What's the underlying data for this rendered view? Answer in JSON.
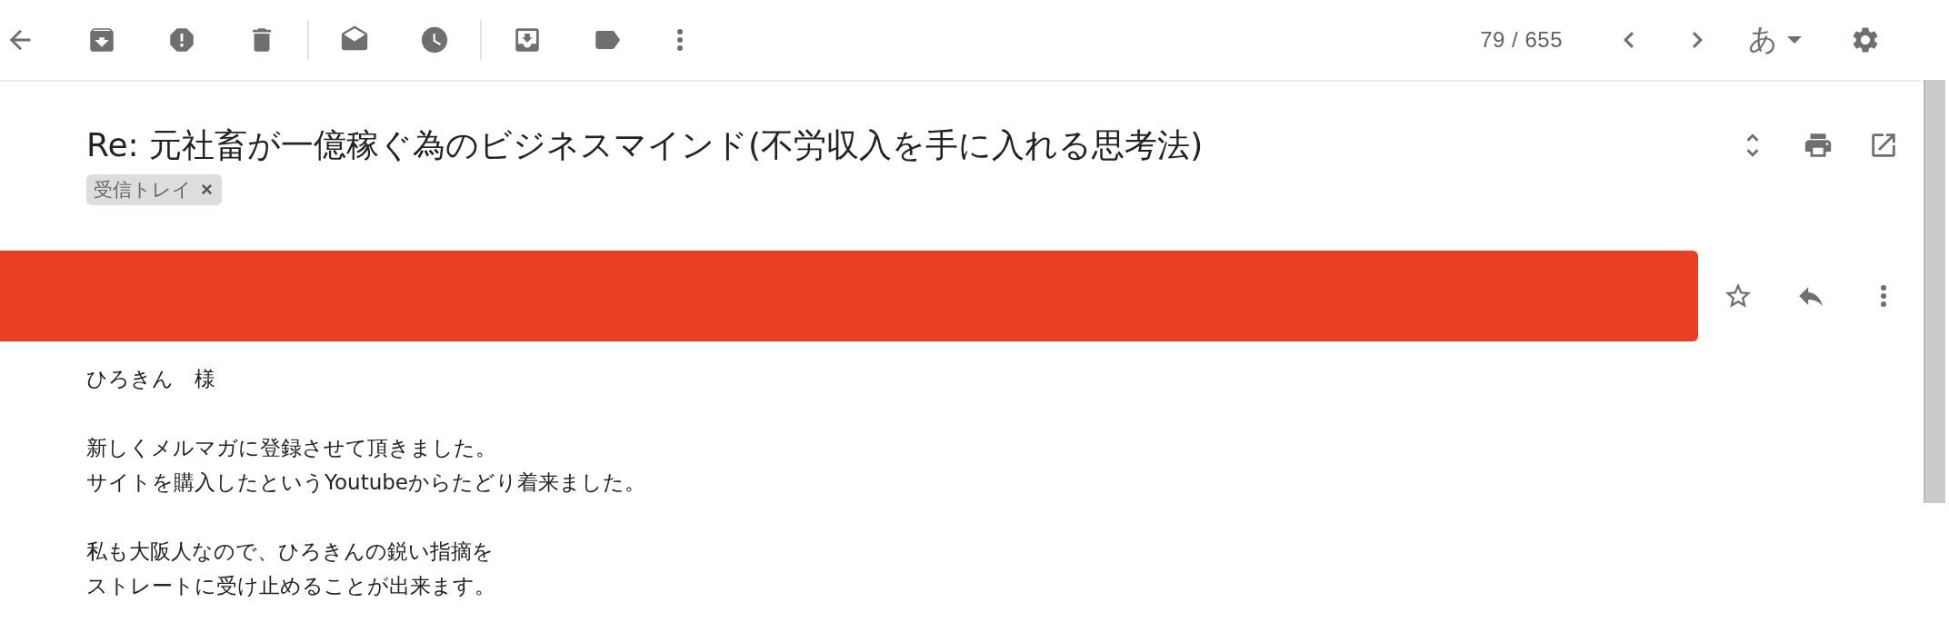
{
  "toolbar": {
    "counter": "79 / 655",
    "input_tool": "あ"
  },
  "message": {
    "subject": "Re: 元社畜が一億稼ぐ為のビジネスマインド(不労収入を手に入れる思考法)",
    "labels": [
      {
        "text": "受信トレイ",
        "remove": "×"
      }
    ],
    "starred": false,
    "body": [
      [
        "ひろきん　様"
      ],
      [
        "新しくメルマガに登録させて頂きました。",
        "サイトを購入したというYoutubeからたどり着来ました。"
      ],
      [
        "私も大阪人なので、ひろきんの鋭い指摘を",
        "ストレートに受け止めることが出来ます。"
      ]
    ]
  }
}
